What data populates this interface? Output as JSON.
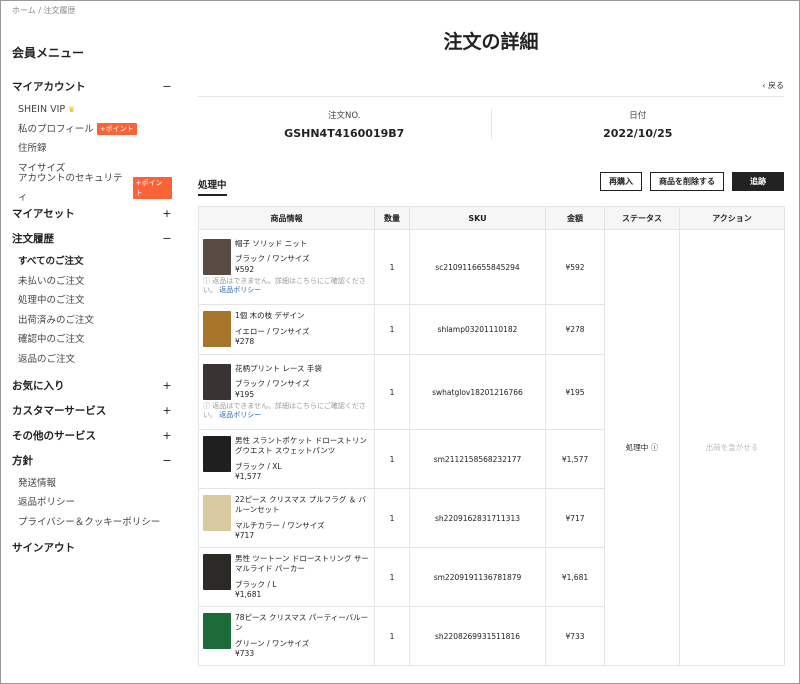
{
  "breadcrumb": {
    "home": "ホーム",
    "sep": "/",
    "current": "注文履歴"
  },
  "sidebar": {
    "title": "会員メニュー",
    "sections": [
      {
        "label": "マイアカウント",
        "toggle": "−",
        "items": [
          {
            "label": "SHEIN VIP",
            "icon": "crown-icon"
          },
          {
            "label": "私のプロフィール",
            "badge": "+ポイント"
          },
          {
            "label": "住所録"
          },
          {
            "label": "マイサイズ"
          },
          {
            "label": "アカウントのセキュリティ",
            "badge": "+ポイント"
          }
        ]
      },
      {
        "label": "マイアセット",
        "toggle": "+",
        "items": []
      },
      {
        "label": "注文履歴",
        "toggle": "−",
        "items": [
          {
            "label": "すべてのご注文",
            "active": true
          },
          {
            "label": "未払いのご注文"
          },
          {
            "label": "処理中のご注文"
          },
          {
            "label": "出荷済みのご注文"
          },
          {
            "label": "確認中のご注文"
          },
          {
            "label": "返品のご注文"
          }
        ]
      },
      {
        "label": "お気に入り",
        "toggle": "+",
        "items": []
      },
      {
        "label": "カスタマーサービス",
        "toggle": "+",
        "items": []
      },
      {
        "label": "その他のサービス",
        "toggle": "+",
        "items": []
      },
      {
        "label": "方針",
        "toggle": "−",
        "items": [
          {
            "label": "発送情報"
          },
          {
            "label": "返品ポリシー"
          },
          {
            "label": "プライバシー＆クッキーポリシー"
          }
        ]
      }
    ],
    "signout": "サインアウト"
  },
  "main": {
    "title": "注文の詳細",
    "back": "戻る",
    "order_no_label": "注文NO.",
    "order_no": "GSHN4T4160019B7",
    "date_label": "日付",
    "date": "2022/10/25",
    "status_tab": "処理中",
    "buttons": {
      "rebuy": "再購入",
      "delete": "商品を削除する",
      "track": "追跡"
    }
  },
  "table": {
    "headers": [
      "商品情報",
      "数量",
      "SKU",
      "金額",
      "ステータス",
      "アクション"
    ],
    "status": "処理中",
    "action": "出荷を急がせる",
    "note": "返品はできません。詳細はこちらにご確認ください。",
    "note_link": "返品ポリシー",
    "rows": [
      {
        "name": "帽子 ソリッド ニット",
        "variant": "ブラック / ワンサイズ",
        "price": "¥592",
        "qty": "1",
        "sku": "sc2109116655845294",
        "amount": "¥592",
        "note": true,
        "thumb": "#5a4a44"
      },
      {
        "name": "1個 木の枝 デザイン",
        "variant": "イエロー / ワンサイズ",
        "price": "¥278",
        "qty": "1",
        "sku": "shlamp03201110182",
        "amount": "¥278",
        "note": false,
        "thumb": "#a6752a"
      },
      {
        "name": "花柄プリント レース 手袋",
        "variant": "ブラック / ワンサイズ",
        "price": "¥195",
        "qty": "1",
        "sku": "swhatglov18201216766",
        "amount": "¥195",
        "note": true,
        "thumb": "#3a3333"
      },
      {
        "name": "男性 スラントポケット ドローストリングウエスト スウェットパンツ",
        "variant": "ブラック / XL",
        "price": "¥1,577",
        "qty": "1",
        "sku": "sm2112158568232177",
        "amount": "¥1,577",
        "note": false,
        "thumb": "#1f1f1f"
      },
      {
        "name": "22ピース クリスマス プルフラグ ＆ バルーンセット",
        "variant": "マルチカラー / ワンサイズ",
        "price": "¥717",
        "qty": "1",
        "sku": "sh2209162831711313",
        "amount": "¥717",
        "note": false,
        "thumb": "#d8c9a0"
      },
      {
        "name": "男性 ツートーン ドローストリング サーマルライド パーカー",
        "variant": "ブラック / L",
        "price": "¥1,681",
        "qty": "1",
        "sku": "sm2209191136781879",
        "amount": "¥1,681",
        "note": false,
        "thumb": "#2c2a26"
      },
      {
        "name": "78ピース クリスマス パーティーバルーン",
        "variant": "グリーン / ワンサイズ",
        "price": "¥733",
        "qty": "1",
        "sku": "sh2208269931511816",
        "amount": "¥733",
        "note": false,
        "thumb": "#1e6b3a"
      }
    ]
  }
}
